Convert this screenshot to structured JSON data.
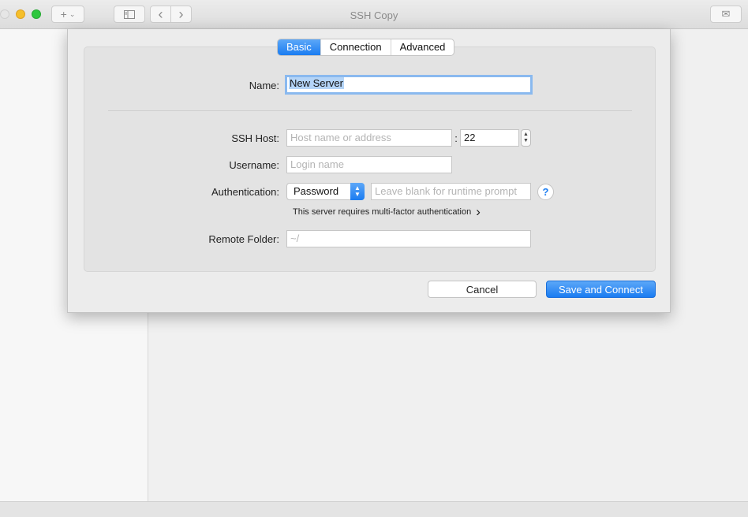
{
  "window": {
    "title": "SSH Copy",
    "toolbar_add_label": "+",
    "toolbar_add_chevron": "⌄",
    "toolbar_back": "‹",
    "toolbar_forward": "›",
    "toolbar_mail_icon": "✉"
  },
  "tabs": [
    {
      "label": "Basic",
      "active": true
    },
    {
      "label": "Connection",
      "active": false
    },
    {
      "label": "Advanced",
      "active": false
    }
  ],
  "form": {
    "name_label": "Name:",
    "name_value": "New Server",
    "ssh_host_label": "SSH Host:",
    "ssh_host_placeholder": "Host name or address",
    "port_separator": ":",
    "port_value": "22",
    "username_label": "Username:",
    "username_placeholder": "Login name",
    "auth_label": "Authentication:",
    "auth_method": "Password",
    "password_placeholder": "Leave blank for runtime prompt",
    "help_glyph": "?",
    "mfa_text": "This server requires multi-factor authentication",
    "mfa_chevron": "›",
    "remote_folder_label": "Remote Folder:",
    "remote_folder_placeholder": "~/"
  },
  "buttons": {
    "cancel": "Cancel",
    "save": "Save and Connect"
  }
}
